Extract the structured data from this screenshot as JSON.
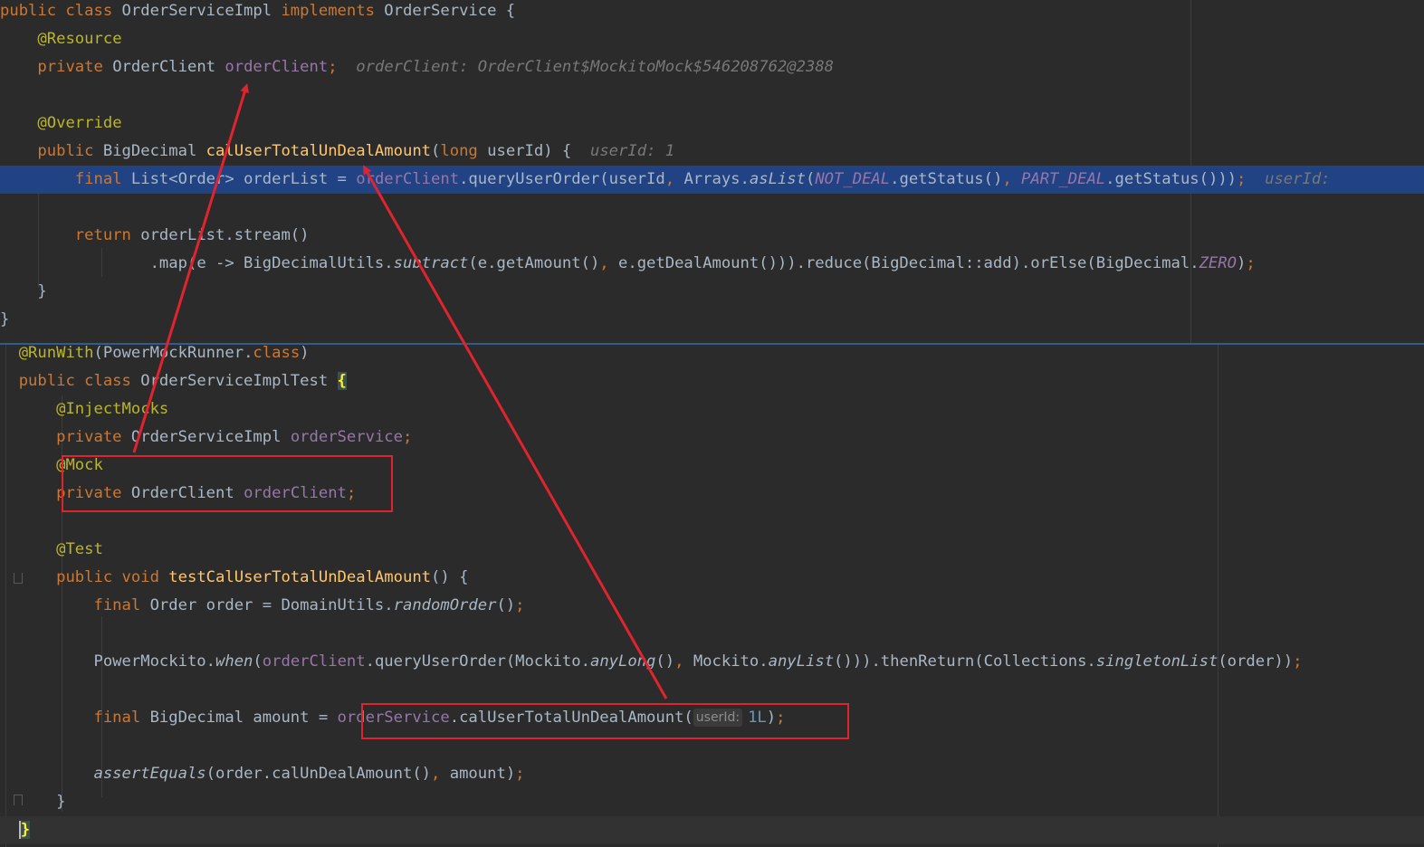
{
  "top": {
    "l1": {
      "a": "public class ",
      "b": "OrderServiceImpl ",
      "c": "implements ",
      "d": "OrderService {"
    },
    "l2": {
      "a": "@Resource"
    },
    "l3": {
      "a": "private ",
      "b": "OrderClient ",
      "c": "orderClient",
      "d": ";",
      "hint": "orderClient: OrderClient$MockitoMock$546208762@2388"
    },
    "l5": {
      "a": "@Override"
    },
    "l6": {
      "a": "public ",
      "b": "BigDecimal ",
      "c": "calUserTotalUnDealAmount",
      "d": "(",
      "e": "long ",
      "f": "userId) {",
      "hint": "userId: 1"
    },
    "l7": {
      "a": "final ",
      "b": "List<Order> orderList = ",
      "c": "orderClient",
      "d": ".queryUserOrder(userId",
      "e": ", ",
      "f": "Arrays.",
      "g": "asList",
      "h": "(",
      "i": "NOT_DEAL",
      "j": ".getStatus()",
      "k": ", ",
      "l": "PART_DEAL",
      "m": ".getStatus()))",
      "n": ";",
      "hint": "userId:"
    },
    "l9": {
      "a": "return ",
      "b": "orderList.stream()"
    },
    "l10": {
      "a": ".map(e -> BigDecimalUtils.",
      "b": "subtract",
      "c": "(e.getAmount()",
      "d": ", ",
      "e": "e.getDealAmount())).reduce(BigDecimal::add).orElse(BigDecimal.",
      "f": "ZERO",
      "g": ")",
      "h": ";"
    },
    "l11": {
      "a": "}"
    },
    "l12": {
      "a": "}"
    }
  },
  "bottom": {
    "l1": {
      "a": "@RunWith",
      "b": "(PowerMockRunner.",
      "c": "class",
      "d": ")"
    },
    "l2": {
      "a": "public class ",
      "b": "OrderServiceImplTest ",
      "c": "{"
    },
    "l3": {
      "a": "@InjectMocks"
    },
    "l4": {
      "a": "private ",
      "b": "OrderServiceImpl ",
      "c": "orderService",
      "d": ";"
    },
    "l5": {
      "a": "@Mock"
    },
    "l6": {
      "a": "private ",
      "b": "OrderClient ",
      "c": "orderClient",
      "d": ";"
    },
    "l8": {
      "a": "@Test"
    },
    "l9": {
      "a": "public void ",
      "b": "testCalUserTotalUnDealAmount",
      "c": "() {"
    },
    "l10": {
      "a": "final ",
      "b": "Order order = DomainUtils.",
      "c": "randomOrder",
      "d": "()",
      "e": ";"
    },
    "l12": {
      "a": "PowerMockito.",
      "b": "when",
      "c": "(",
      "d": "orderClient",
      "e": ".queryUserOrder(Mockito.",
      "f": "anyLong",
      "g": "()",
      "h": ", ",
      "i": "Mockito.",
      "j": "anyList",
      "k": "())).thenReturn(Collections.",
      "l": "singletonList",
      "m": "(order))",
      "n": ";"
    },
    "l14": {
      "a": "final ",
      "b": "BigDecimal amount = ",
      "c": "orderService",
      "d": ".calUserTotalUnDealAmount(",
      "hint": "userId:",
      "e": "1L",
      "f": ")",
      "g": ";"
    },
    "l16": {
      "a": "assertEquals",
      "b": "(order.calUnDealAmount()",
      "c": ", ",
      "d": "amount)",
      "e": ";"
    },
    "l17": {
      "a": "}"
    },
    "l18": {
      "a": "}"
    }
  },
  "colors": {
    "annotation_red": "#e0242f",
    "caret_line": "#214283"
  }
}
